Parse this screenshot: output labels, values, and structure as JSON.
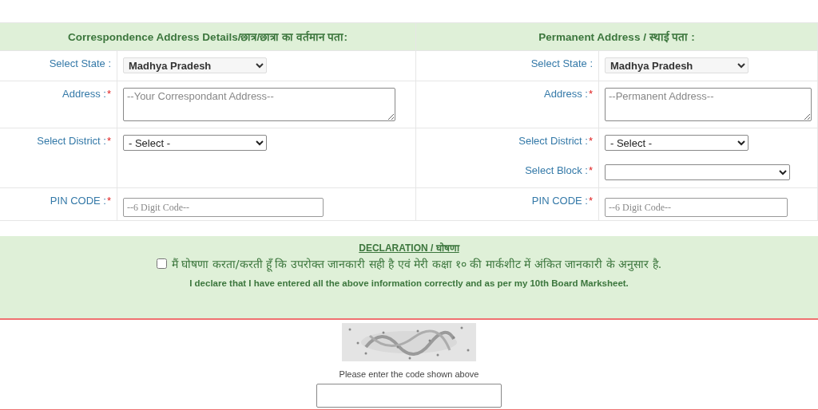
{
  "address_sections": [
    {
      "title": "Correspondence Address Details/छात्र/छात्रा का वर्तमान पता:",
      "rows": [
        {
          "fields": [
            {
              "kind": "select",
              "label": "Select State :",
              "value": "Madhya Pradesh",
              "disabled": true
            }
          ]
        },
        {
          "fields": [
            {
              "kind": "textarea",
              "label": "Address :",
              "mark": "*",
              "placeholder": "--Your Correspondant Address--"
            }
          ]
        },
        {
          "fields": [
            {
              "kind": "select",
              "label": "Select District :",
              "mark": "*",
              "value": "- Select -",
              "disabled": false
            }
          ]
        },
        {
          "fields": [
            {
              "kind": "input",
              "label": "PIN CODE :",
              "mark": "*",
              "placeholder": "--6 Digit Code--"
            }
          ]
        }
      ]
    },
    {
      "title": "Permanent Address / स्थाई पता :",
      "rows": [
        {
          "fields": [
            {
              "kind": "select",
              "label": "Select State :",
              "value": "Madhya Pradesh",
              "disabled": true
            }
          ]
        },
        {
          "fields": [
            {
              "kind": "textarea",
              "label": "Address :",
              "mark": "*",
              "placeholder": "--Permanent Address--"
            }
          ]
        },
        {
          "fields": [
            {
              "kind": "select",
              "label": "Select District :",
              "mark": "*",
              "value": "- Select -",
              "disabled": false
            },
            {
              "kind": "select",
              "label": "Select Block :",
              "mark": "*",
              "disabled": false,
              "wide": true
            }
          ]
        },
        {
          "fields": [
            {
              "kind": "input",
              "label": "PIN CODE :",
              "mark": "*",
              "placeholder": "--6 Digit Code--"
            }
          ]
        }
      ]
    }
  ],
  "declaration": {
    "heading": "DECLARATION / घोषणा",
    "checked": false,
    "hindi_text": "मैं घोषणा करता/करती हूँ कि उपरोक्त जानकारी सही है एवं मेरी कक्षा १० की मार्कशीट में अंकित जानकारी के अनुसार है.",
    "english_text": "I declare that I have entered all the above information correctly and as per my 10th Board Marksheet."
  },
  "captcha": {
    "prompt": "Please enter the code shown above"
  }
}
